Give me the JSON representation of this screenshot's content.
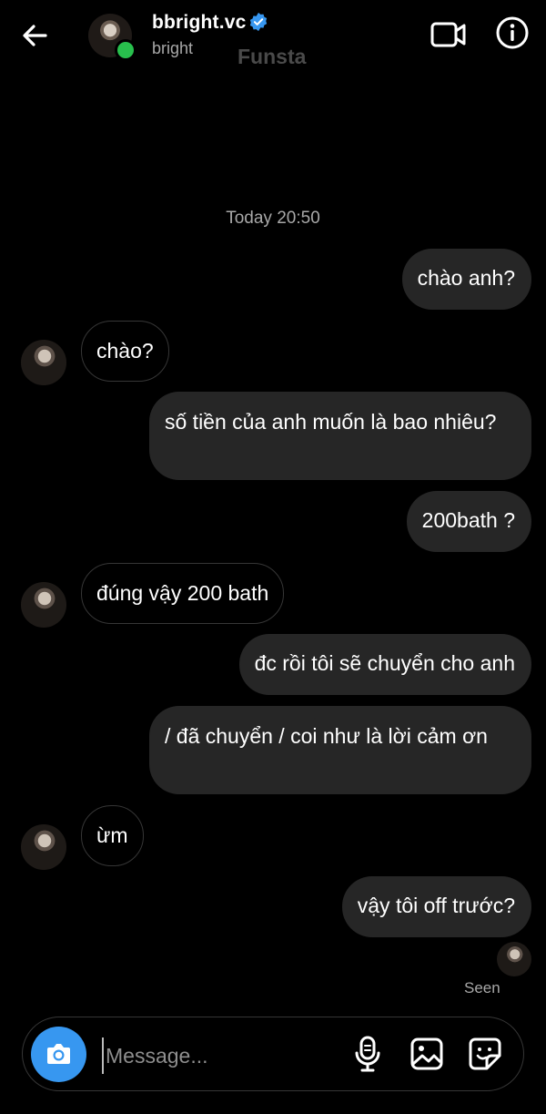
{
  "header": {
    "username": "bbright.vc",
    "display_name": "bright",
    "watermark": "Funsta",
    "verified": true,
    "online": true,
    "icons": {
      "back": "arrow-left-icon",
      "video": "video-camera-icon",
      "info": "info-icon",
      "verified": "verified-badge-icon"
    }
  },
  "thread": {
    "timestamp": "Today 20:50",
    "messages": [
      {
        "from": "me",
        "text": "chào anh?"
      },
      {
        "from": "them",
        "text": "chào?"
      },
      {
        "from": "me",
        "text": "số tiền của anh muốn là bao nhiêu?"
      },
      {
        "from": "me",
        "text": "200bath ?"
      },
      {
        "from": "them",
        "text": "đúng vậy 200 bath"
      },
      {
        "from": "me",
        "text": "đc rồi tôi sẽ chuyển cho anh"
      },
      {
        "from": "me",
        "text": "/ đã chuyển / coi như là lời cảm ơn"
      },
      {
        "from": "them",
        "text": "ừm"
      },
      {
        "from": "me",
        "text": "vậy tôi off trước?"
      }
    ],
    "seen_label": "Seen"
  },
  "composer": {
    "placeholder": "Message...",
    "value": "",
    "icons": [
      "camera-icon",
      "microphone-icon",
      "image-icon",
      "sticker-icon"
    ]
  },
  "colors": {
    "background": "#000000",
    "sent_bubble": "#262626",
    "accent_blue": "#3797f0",
    "online_green": "#28c04d",
    "muted_text": "#a8a8a8"
  }
}
